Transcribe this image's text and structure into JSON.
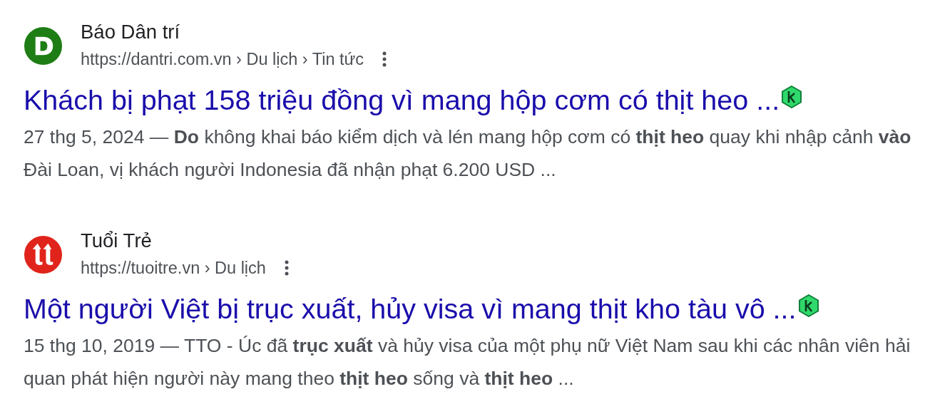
{
  "results": [
    {
      "kind": "letter",
      "color": "#1e7d14",
      "site": "Báo Dân trí",
      "url": "https://dantri.com.vn › Du lịch › Tin tức",
      "title": "Khách bị phạt 158 triệu đồng vì mang hộp cơm có thịt heo ...",
      "badge": true,
      "snippet": "27 thg 5, 2024 — **Do** không khai báo kiểm dịch và lén mang hộp cơm có **thịt heo** quay khi nhập cảnh **vào** Đài Loan, vị khách người Indonesia đã nhận phạt 6.200 USD ..."
    },
    {
      "kind": "twin",
      "color": "#e0241b",
      "site": "Tuổi Trẻ",
      "url": "https://tuoitre.vn › Du lịch",
      "title": "Một người Việt bị trục xuất, hủy visa vì mang thịt kho tàu vô ...",
      "badge": true,
      "snippet": "15 thg 10, 2019 — TTO - Úc đã **trục xuất** và hủy visa của một phụ nữ Việt Nam sau khi các nhân viên hải quan phát hiện người này mang theo **thịt heo** sống và **thịt heo** ..."
    }
  ]
}
